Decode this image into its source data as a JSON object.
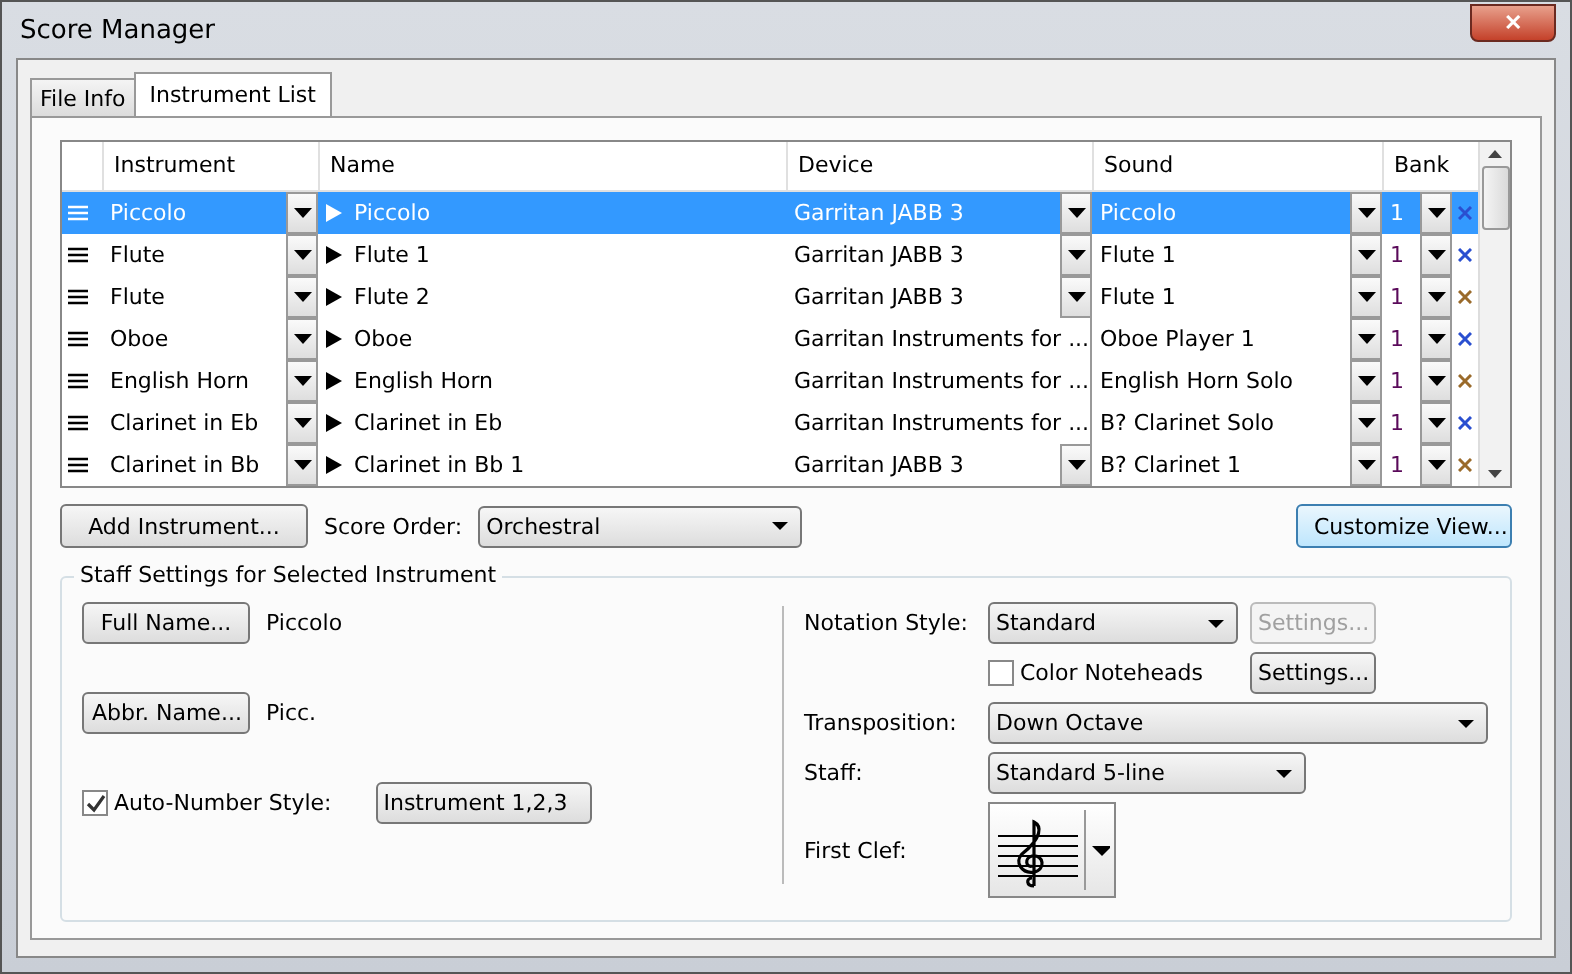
{
  "window": {
    "title": "Score Manager",
    "close": "✕"
  },
  "tabs": [
    {
      "label": "File Info",
      "selected": false
    },
    {
      "label": "Instrument List",
      "selected": true
    }
  ],
  "table": {
    "columns": [
      "Instrument",
      "Name",
      "Device",
      "Sound",
      "Bank"
    ],
    "rows": [
      {
        "instrument": "Piccolo",
        "name": "Piccolo",
        "device": "Garritan JABB 3",
        "sound": "Piccolo",
        "bank": "1",
        "selected": true,
        "color": "#2a4fd0"
      },
      {
        "instrument": "Flute",
        "name": "Flute 1",
        "device": "Garritan JABB 3",
        "sound": "Flute 1",
        "bank": "1",
        "selected": false,
        "color": "#2a4fd0"
      },
      {
        "instrument": "Flute",
        "name": "Flute 2",
        "device": "Garritan JABB 3",
        "sound": "Flute 1",
        "bank": "1",
        "selected": false,
        "color": "#9a6a2a"
      },
      {
        "instrument": "Oboe",
        "name": "Oboe",
        "device": "Garritan Instruments for ...",
        "sound": "Oboe Player 1",
        "bank": "1",
        "selected": false,
        "color": "#2a4fd0"
      },
      {
        "instrument": "English Horn",
        "name": "English Horn",
        "device": "Garritan Instruments for ...",
        "sound": "English Horn Solo",
        "bank": "1",
        "selected": false,
        "color": "#9a6a2a"
      },
      {
        "instrument": "Clarinet in Eb",
        "name": "Clarinet in Eb",
        "device": "Garritan Instruments for ...",
        "sound": "B? Clarinet Solo",
        "bank": "1",
        "selected": false,
        "color": "#2a4fd0"
      },
      {
        "instrument": "Clarinet in Bb",
        "name": "Clarinet in Bb 1",
        "device": "Garritan JABB 3",
        "sound": "B? Clarinet 1",
        "bank": "1",
        "selected": false,
        "color": "#9a6a2a"
      }
    ]
  },
  "add_button": "Add Instrument...",
  "score_order": {
    "label": "Score Order:",
    "value": "Orchestral"
  },
  "customize_button": "Customize View...",
  "staff_settings": {
    "title": "Staff Settings for Selected Instrument",
    "full_name_button": "Full Name...",
    "full_name": "Piccolo",
    "abbr_name_button": "Abbr. Name...",
    "abbr_name": "Picc.",
    "auto_number": {
      "label": "Auto-Number Style:",
      "checked": true,
      "value": "Instrument 1,2,3"
    },
    "notation_style": {
      "label": "Notation Style:",
      "value": "Standard"
    },
    "settings_button": {
      "label": "Settings...",
      "disabled": true
    },
    "color_noteheads": {
      "label": "Color Noteheads",
      "checked": false
    },
    "settings_button_2": {
      "label": "Settings...",
      "disabled": false
    },
    "transposition": {
      "label": "Transposition:",
      "value": "Down Octave"
    },
    "staff": {
      "label": "Staff:",
      "value": "Standard 5-line"
    },
    "first_clef": {
      "label": "First Clef:"
    }
  }
}
